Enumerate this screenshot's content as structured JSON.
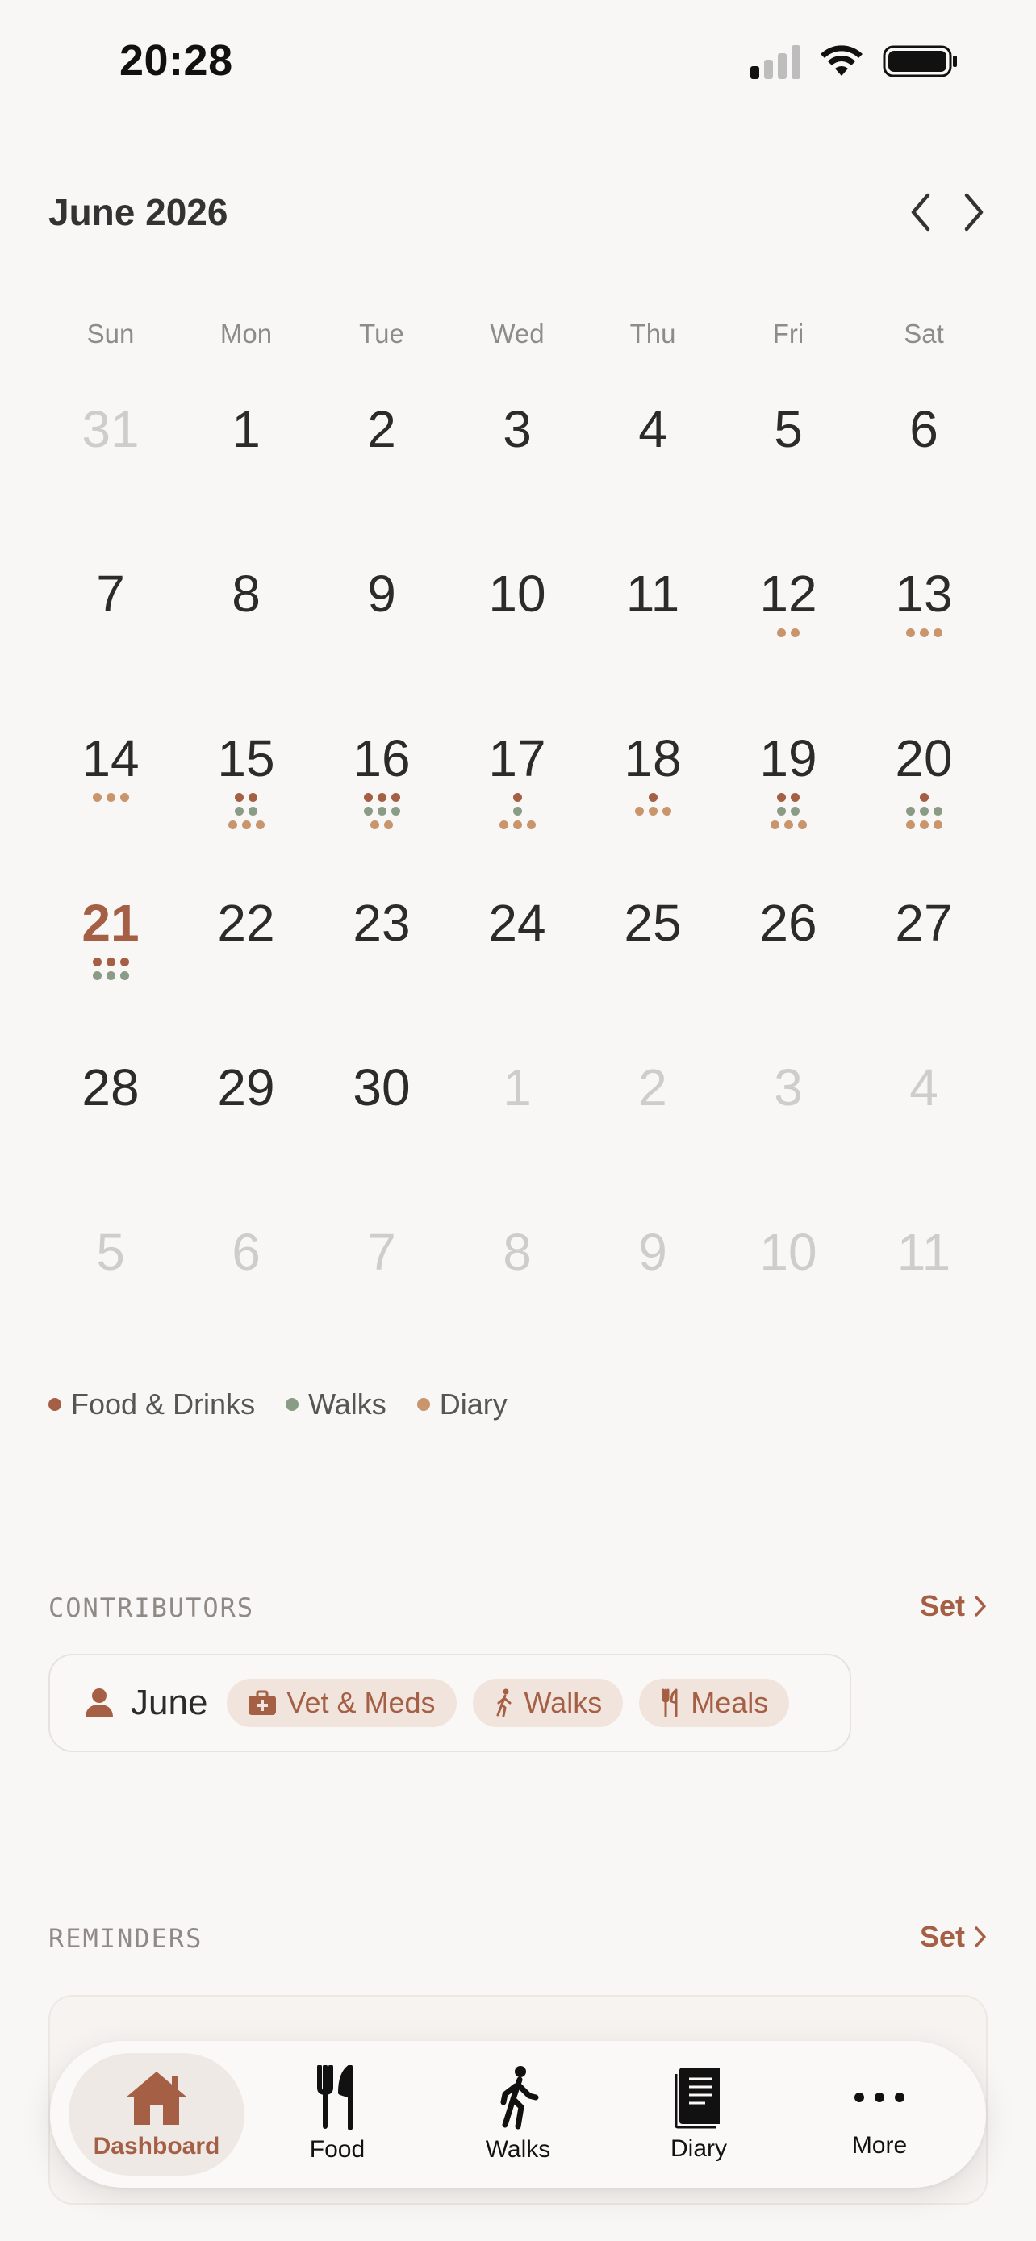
{
  "status_bar": {
    "time": "20:28"
  },
  "calendar": {
    "title": "June 2026",
    "weekdays": [
      "Sun",
      "Mon",
      "Tue",
      "Wed",
      "Thu",
      "Fri",
      "Sat"
    ],
    "weeks": [
      [
        {
          "d": "31",
          "muted": true
        },
        {
          "d": "1"
        },
        {
          "d": "2"
        },
        {
          "d": "3"
        },
        {
          "d": "4"
        },
        {
          "d": "5"
        },
        {
          "d": "6"
        }
      ],
      [
        {
          "d": "7"
        },
        {
          "d": "8"
        },
        {
          "d": "9"
        },
        {
          "d": "10"
        },
        {
          "d": "11"
        },
        {
          "d": "12",
          "dots": [
            [],
            [],
            [
              "diary",
              "diary"
            ]
          ]
        },
        {
          "d": "13",
          "dots": [
            [],
            [],
            [
              "diary",
              "diary",
              "diary"
            ]
          ]
        }
      ],
      [
        {
          "d": "14",
          "dots": [
            [],
            [],
            [
              "diary",
              "diary",
              "diary"
            ]
          ]
        },
        {
          "d": "15",
          "dots": [
            [
              "food",
              "food"
            ],
            [
              "walk",
              "walk"
            ],
            [
              "diary",
              "diary",
              "diary"
            ]
          ]
        },
        {
          "d": "16",
          "dots": [
            [
              "food",
              "food",
              "food"
            ],
            [
              "walk",
              "walk",
              "walk"
            ],
            [
              "diary",
              "diary"
            ]
          ]
        },
        {
          "d": "17",
          "dots": [
            [
              "food"
            ],
            [
              "walk"
            ],
            [
              "diary",
              "diary",
              "diary"
            ]
          ]
        },
        {
          "d": "18",
          "dots": [
            [
              "food"
            ],
            [],
            [
              "diary",
              "diary",
              "diary"
            ]
          ]
        },
        {
          "d": "19",
          "dots": [
            [
              "food",
              "food"
            ],
            [
              "walk",
              "walk"
            ],
            [
              "diary",
              "diary",
              "diary"
            ]
          ]
        },
        {
          "d": "20",
          "dots": [
            [
              "food"
            ],
            [
              "walk",
              "walk",
              "walk"
            ],
            [
              "diary",
              "diary",
              "diary"
            ]
          ]
        }
      ],
      [
        {
          "d": "21",
          "today": true,
          "dots": [
            [
              "food",
              "food",
              "food"
            ],
            [
              "walk",
              "walk",
              "walk"
            ]
          ]
        },
        {
          "d": "22"
        },
        {
          "d": "23"
        },
        {
          "d": "24"
        },
        {
          "d": "25"
        },
        {
          "d": "26"
        },
        {
          "d": "27"
        }
      ],
      [
        {
          "d": "28"
        },
        {
          "d": "29"
        },
        {
          "d": "30"
        },
        {
          "d": "1",
          "muted": true
        },
        {
          "d": "2",
          "muted": true
        },
        {
          "d": "3",
          "muted": true
        },
        {
          "d": "4",
          "muted": true
        }
      ],
      [
        {
          "d": "5",
          "muted": true
        },
        {
          "d": "6",
          "muted": true
        },
        {
          "d": "7",
          "muted": true
        },
        {
          "d": "8",
          "muted": true
        },
        {
          "d": "9",
          "muted": true
        },
        {
          "d": "10",
          "muted": true
        },
        {
          "d": "11",
          "muted": true
        }
      ]
    ]
  },
  "legend": {
    "food": "Food & Drinks",
    "walks": "Walks",
    "diary": "Diary"
  },
  "colors": {
    "food": "#a45f44",
    "walk": "#8a9b86",
    "diary": "#c9956c",
    "accent": "#a45f44"
  },
  "contributors": {
    "section_title": "CONTRIBUTORS",
    "set_label": "Set",
    "name": "June",
    "chips": [
      {
        "icon": "medkit-icon",
        "label": "Vet & Meds"
      },
      {
        "icon": "walking-icon",
        "label": "Walks"
      },
      {
        "icon": "utensils-icon",
        "label": "Meals"
      }
    ]
  },
  "reminders": {
    "section_title": "REMINDERS",
    "set_label": "Set"
  },
  "tab_bar": {
    "tabs": [
      {
        "label": "Dashboard",
        "icon": "house-icon",
        "active": true
      },
      {
        "label": "Food",
        "icon": "fork-knife-icon"
      },
      {
        "label": "Walks",
        "icon": "walking-person-icon"
      },
      {
        "label": "Diary",
        "icon": "notebook-icon"
      },
      {
        "label": "More",
        "icon": "ellipsis-icon"
      }
    ]
  }
}
